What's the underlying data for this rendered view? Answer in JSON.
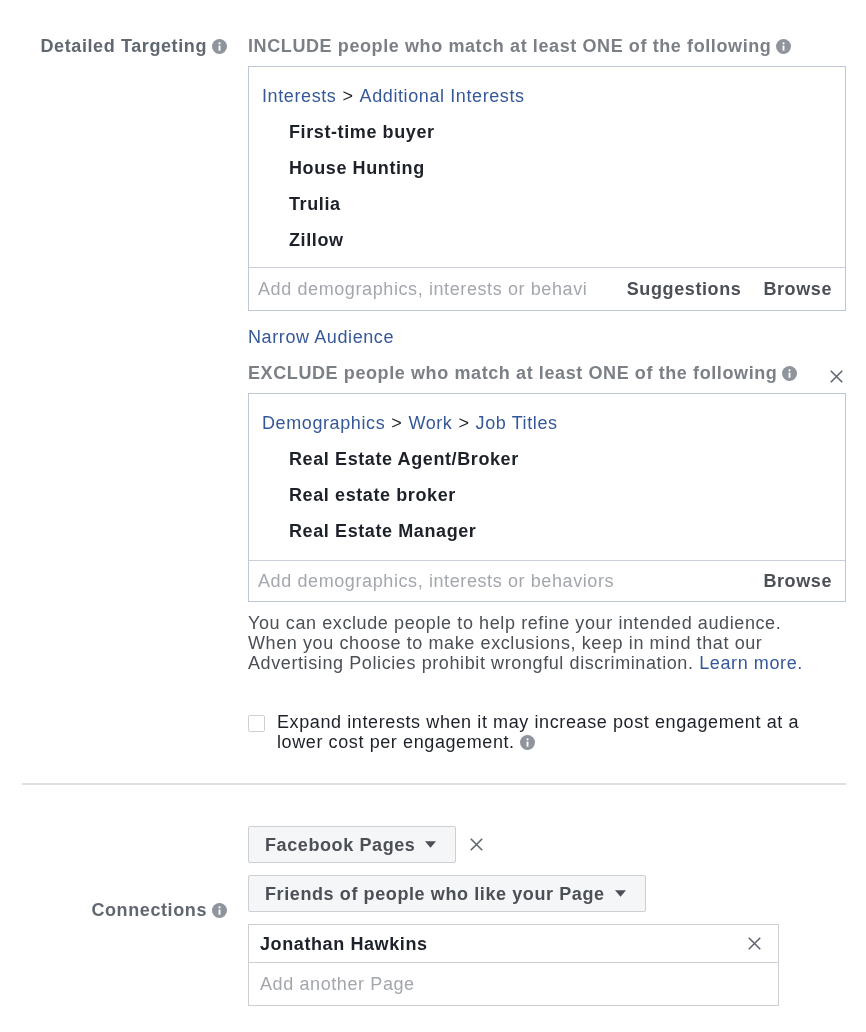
{
  "detailed_targeting": {
    "label": "Detailed Targeting",
    "include": {
      "heading": "INCLUDE people who match at least ONE of the following",
      "breadcrumb": [
        {
          "kind": "link",
          "text": "Interests"
        },
        {
          "kind": "separator",
          "text": ">"
        },
        {
          "kind": "link",
          "text": "Additional Interests"
        }
      ],
      "items": [
        "First-time buyer",
        "House Hunting",
        "Trulia",
        "Zillow"
      ],
      "search": {
        "placeholder": "Add demographics, interests or behavi"
      },
      "buttons": [
        "Suggestions",
        "Browse"
      ]
    },
    "narrow_link": "Narrow Audience",
    "exclude": {
      "heading": "EXCLUDE people who match at least ONE of the following",
      "removable": true,
      "breadcrumb": [
        {
          "kind": "link",
          "text": "Demographics"
        },
        {
          "kind": "separator",
          "text": ">"
        },
        {
          "kind": "link",
          "text": "Work"
        },
        {
          "kind": "separator",
          "text": ">"
        },
        {
          "kind": "link",
          "text": "Job Titles"
        }
      ],
      "items": [
        "Real Estate Agent/Broker",
        "Real estate broker",
        "Real Estate Manager"
      ],
      "search": {
        "placeholder": "Add demographics, interests or behaviors"
      },
      "buttons": [
        "Browse"
      ]
    },
    "disclaimer": {
      "text": "You can exclude people to help refine your intended audience. When you choose to make exclusions, keep in mind that our Advertising Policies prohibit wrongful discrimination.",
      "link": "Learn more."
    },
    "expand_interests": {
      "label": "Expand interests when it may increase post engagement at a lower cost per engagement.",
      "checked": false
    }
  },
  "connections": {
    "label": "Connections",
    "dropdowns": [
      {
        "label": "Facebook Pages",
        "removable": true
      },
      {
        "label": "Friends of people who like your Page",
        "removable": false
      }
    ],
    "pages": [
      {
        "name": "Jonathan Hawkins"
      }
    ],
    "search": {
      "placeholder": "Add another Page"
    }
  }
}
